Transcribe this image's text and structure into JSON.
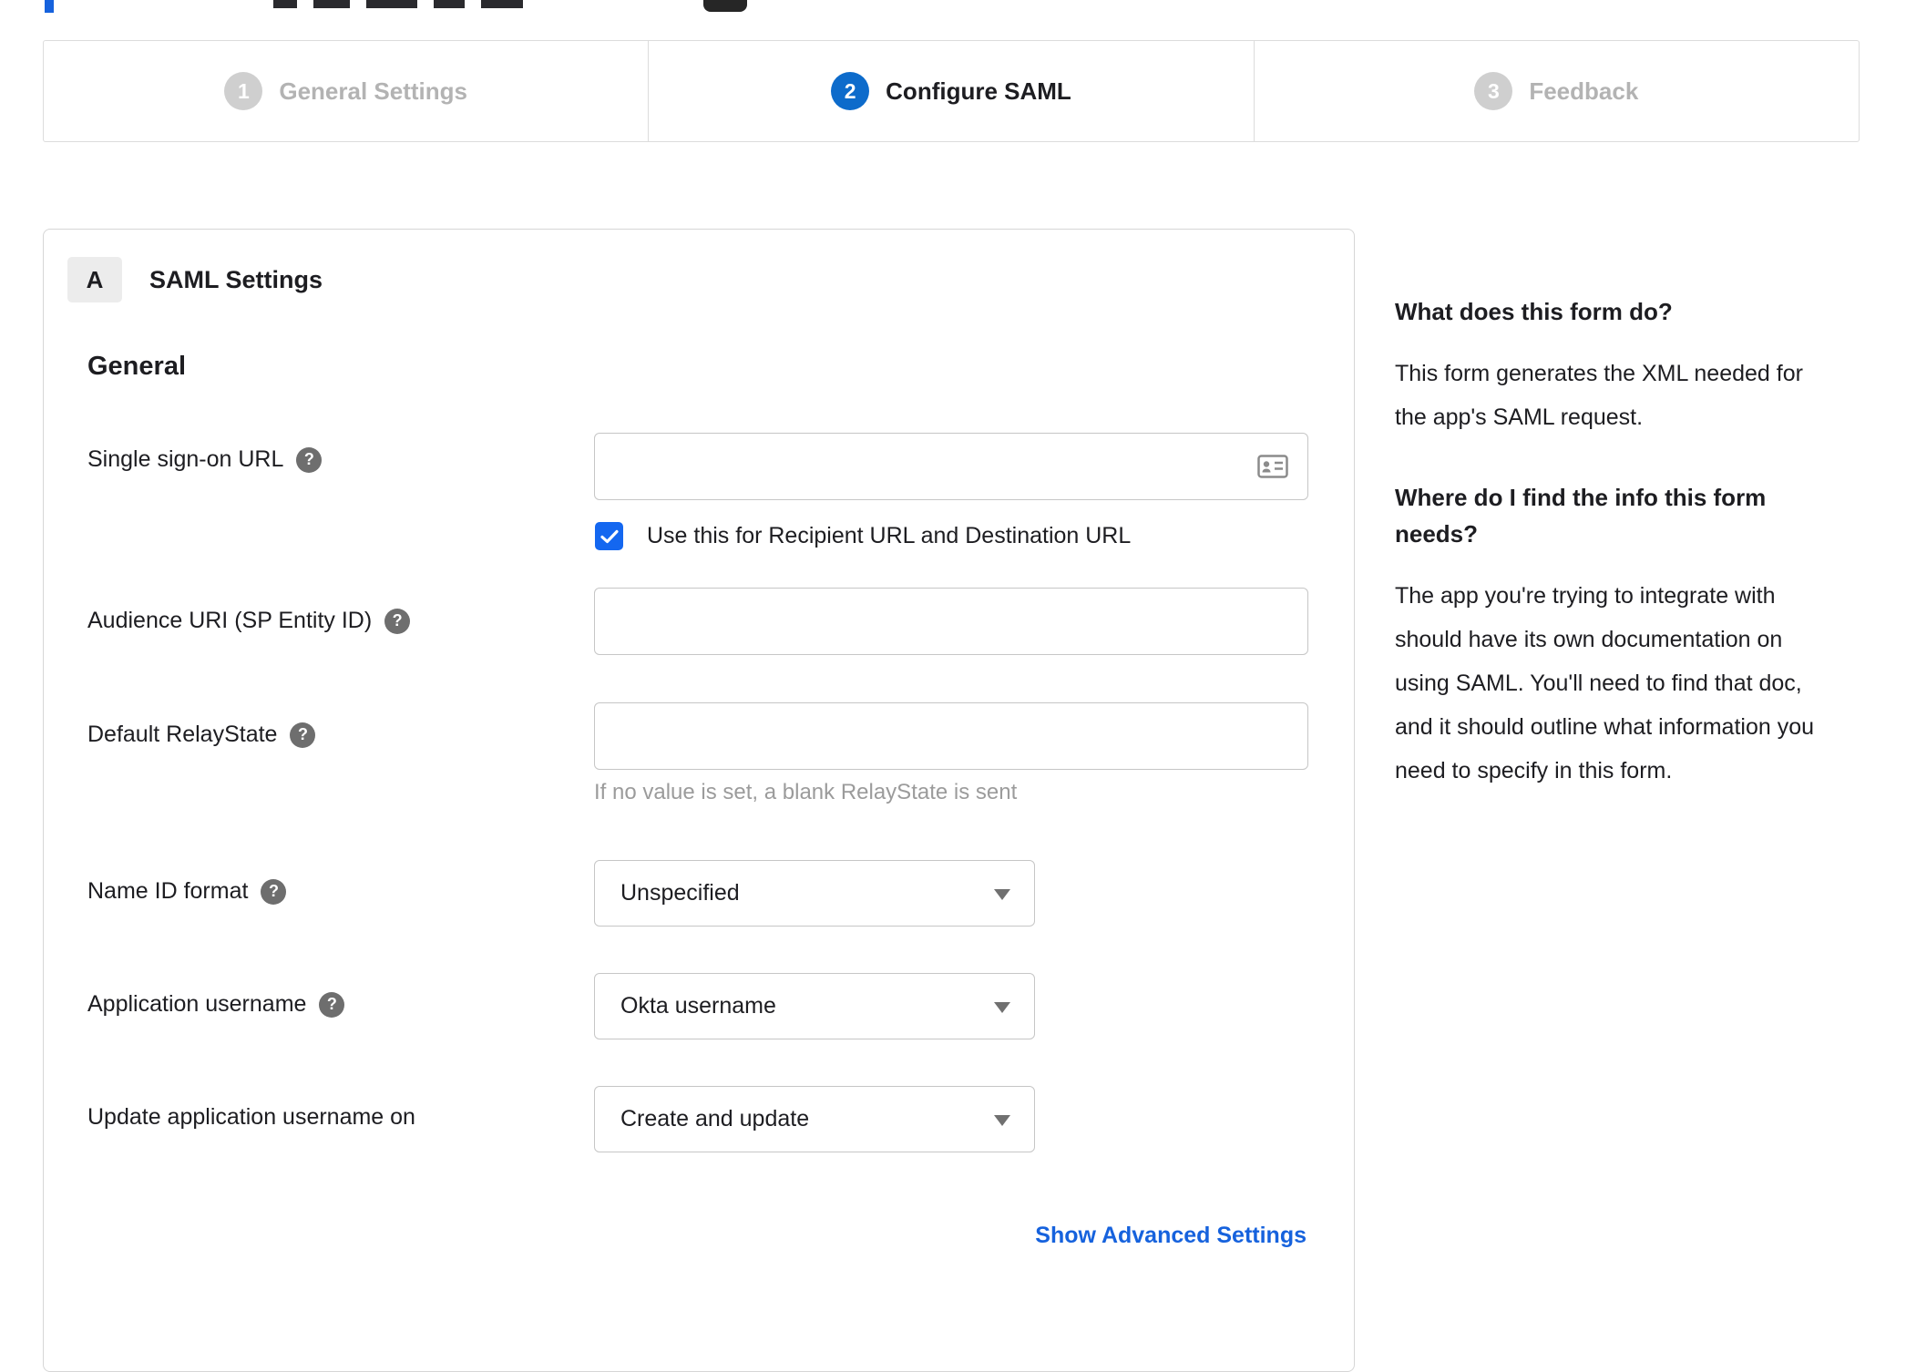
{
  "colors": {
    "accent_blue": "#0d6bcb",
    "checkbox_blue": "#1467f0",
    "link_blue": "#1662dd",
    "inactive_gray": "#cfcfcf",
    "hint_gray": "#9b9b9b"
  },
  "stepper": {
    "steps": [
      {
        "number": "1",
        "label": "General Settings",
        "state": "inactive"
      },
      {
        "number": "2",
        "label": "Configure SAML",
        "state": "active"
      },
      {
        "number": "3",
        "label": "Feedback",
        "state": "inactive"
      }
    ]
  },
  "panel": {
    "badge": "A",
    "title": "SAML Settings",
    "group_title": "General",
    "fields": [
      {
        "label": "Single sign-on URL",
        "type": "text",
        "value": "",
        "checkbox_checked": true,
        "checkbox_label": "Use this for Recipient URL and Destination URL"
      },
      {
        "label": "Audience URI (SP Entity ID)",
        "type": "text",
        "value": ""
      },
      {
        "label": "Default RelayState",
        "type": "text",
        "value": "",
        "hint": "If no value is set, a blank RelayState is sent"
      },
      {
        "label": "Name ID format",
        "type": "select",
        "value": "Unspecified"
      },
      {
        "label": "Application username",
        "type": "select",
        "value": "Okta username"
      },
      {
        "label": "Update application username on",
        "type": "select",
        "value": "Create and update"
      }
    ],
    "advanced_link": "Show Advanced Settings"
  },
  "sidebar": {
    "heading1": "What does this form do?",
    "para1": "This form generates the XML needed for the app's SAML request.",
    "heading2": "Where do I find the info this form needs?",
    "para2": "The app you're trying to integrate with should have its own documentation on using SAML. You'll need to find that doc, and it should outline what information you need to specify in this form."
  }
}
